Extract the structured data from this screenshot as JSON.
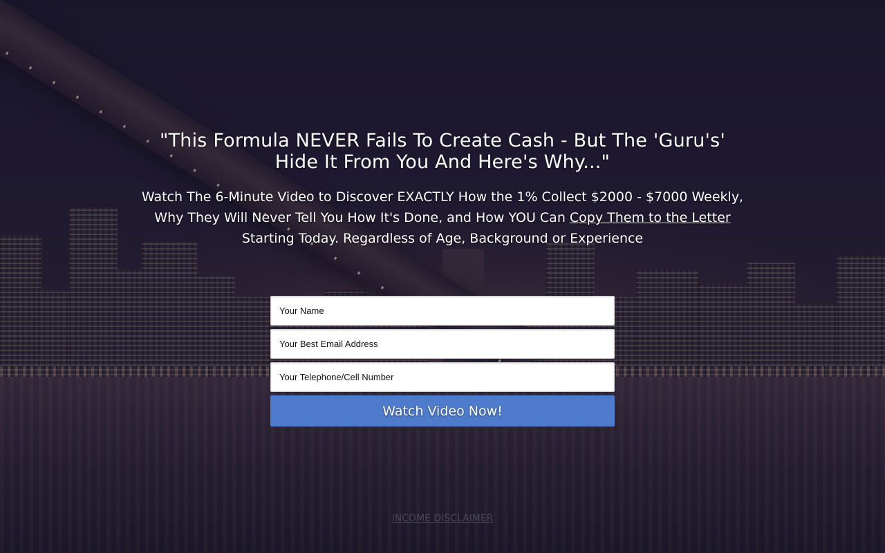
{
  "headline": {
    "line1": "\"This Formula NEVER Fails To Create Cash - But The 'Guru's'",
    "line2": "Hide It From You And Here's Why...\""
  },
  "subhead": {
    "line1": "Watch The 6-Minute Video to Discover EXACTLY How the 1% Collect $2000 - $7000 Weekly,",
    "line2_before": "Why They Will Never Tell You How It's Done, and How YOU Can ",
    "line2_link": "Copy Them to the Letter",
    "line3": "Starting Today. Regardless of Age, Background or Experience"
  },
  "form": {
    "name_placeholder": "Your Name",
    "email_placeholder": "Your Best Email Address",
    "phone_placeholder": "Your Telephone/Cell Number",
    "submit_label": "Watch Video Now!"
  },
  "footer": {
    "disclaimer_link": "INCOME DISCLAIMER"
  },
  "colors": {
    "button_bg": "#4f7bcc",
    "text": "#ffffff"
  }
}
